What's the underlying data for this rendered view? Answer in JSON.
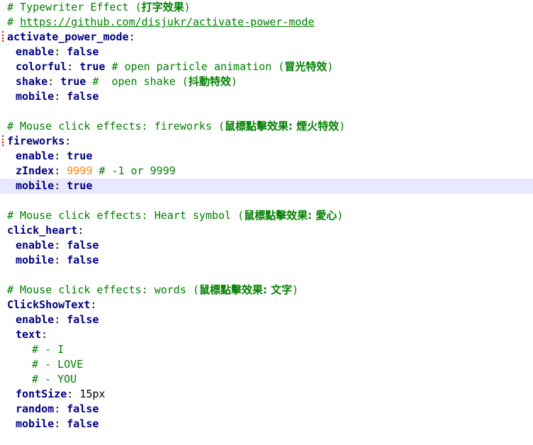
{
  "editor": {
    "lines": [
      {
        "comment": "# Typewriter Effect (",
        "cjk": "打字效果",
        "tail": ")"
      },
      {
        "comment": "# ",
        "link": "https://github.com/disjukr/activate-power-mode"
      },
      {
        "key": "activate_power_mode"
      },
      {
        "key": "enable",
        "value": "false"
      },
      {
        "key": "colorful",
        "value": "true",
        "comment": " # open particle animation (",
        "cjk": "冒光特效",
        "tail": ")"
      },
      {
        "key": "shake",
        "value": "true",
        "comment": " #  open shake (",
        "cjk": "抖動特效",
        "tail": ")"
      },
      {
        "key": "mobile",
        "value": "false"
      },
      {},
      {
        "comment": "# Mouse click effects: fireworks (",
        "cjk": "鼠標點擊效果: 煙火特效",
        "tail": ")"
      },
      {
        "key": "fireworks"
      },
      {
        "key": "enable",
        "value": "true"
      },
      {
        "key": "zIndex",
        "number": "9999",
        "comment": " # -1 or 9999"
      },
      {
        "key": "mobile",
        "value": "true"
      },
      {},
      {
        "comment": "# Mouse click effects: Heart symbol (",
        "cjk": "鼠標點擊效果: 愛心",
        "tail": ")"
      },
      {
        "key": "click_heart"
      },
      {
        "key": "enable",
        "value": "false"
      },
      {
        "key": "mobile",
        "value": "false"
      },
      {},
      {
        "comment": "# Mouse click effects: words (",
        "cjk": "鼠標點擊效果: 文字",
        "tail": ")"
      },
      {
        "key": "ClickShowText"
      },
      {
        "key": "enable",
        "value": "false"
      },
      {
        "key": "text"
      },
      {
        "comment": "# - I"
      },
      {
        "comment": "# - LOVE"
      },
      {
        "comment": "# - YOU"
      },
      {
        "key": "fontSize",
        "plain": "15px"
      },
      {
        "key": "random",
        "value": "false"
      },
      {
        "key": "mobile",
        "value": "false"
      }
    ]
  },
  "colors": {
    "comment": "#008000",
    "key": "#000080",
    "number": "#ff8000",
    "current_line": "#e8e8ff",
    "fold_marker": "#cc0000"
  }
}
